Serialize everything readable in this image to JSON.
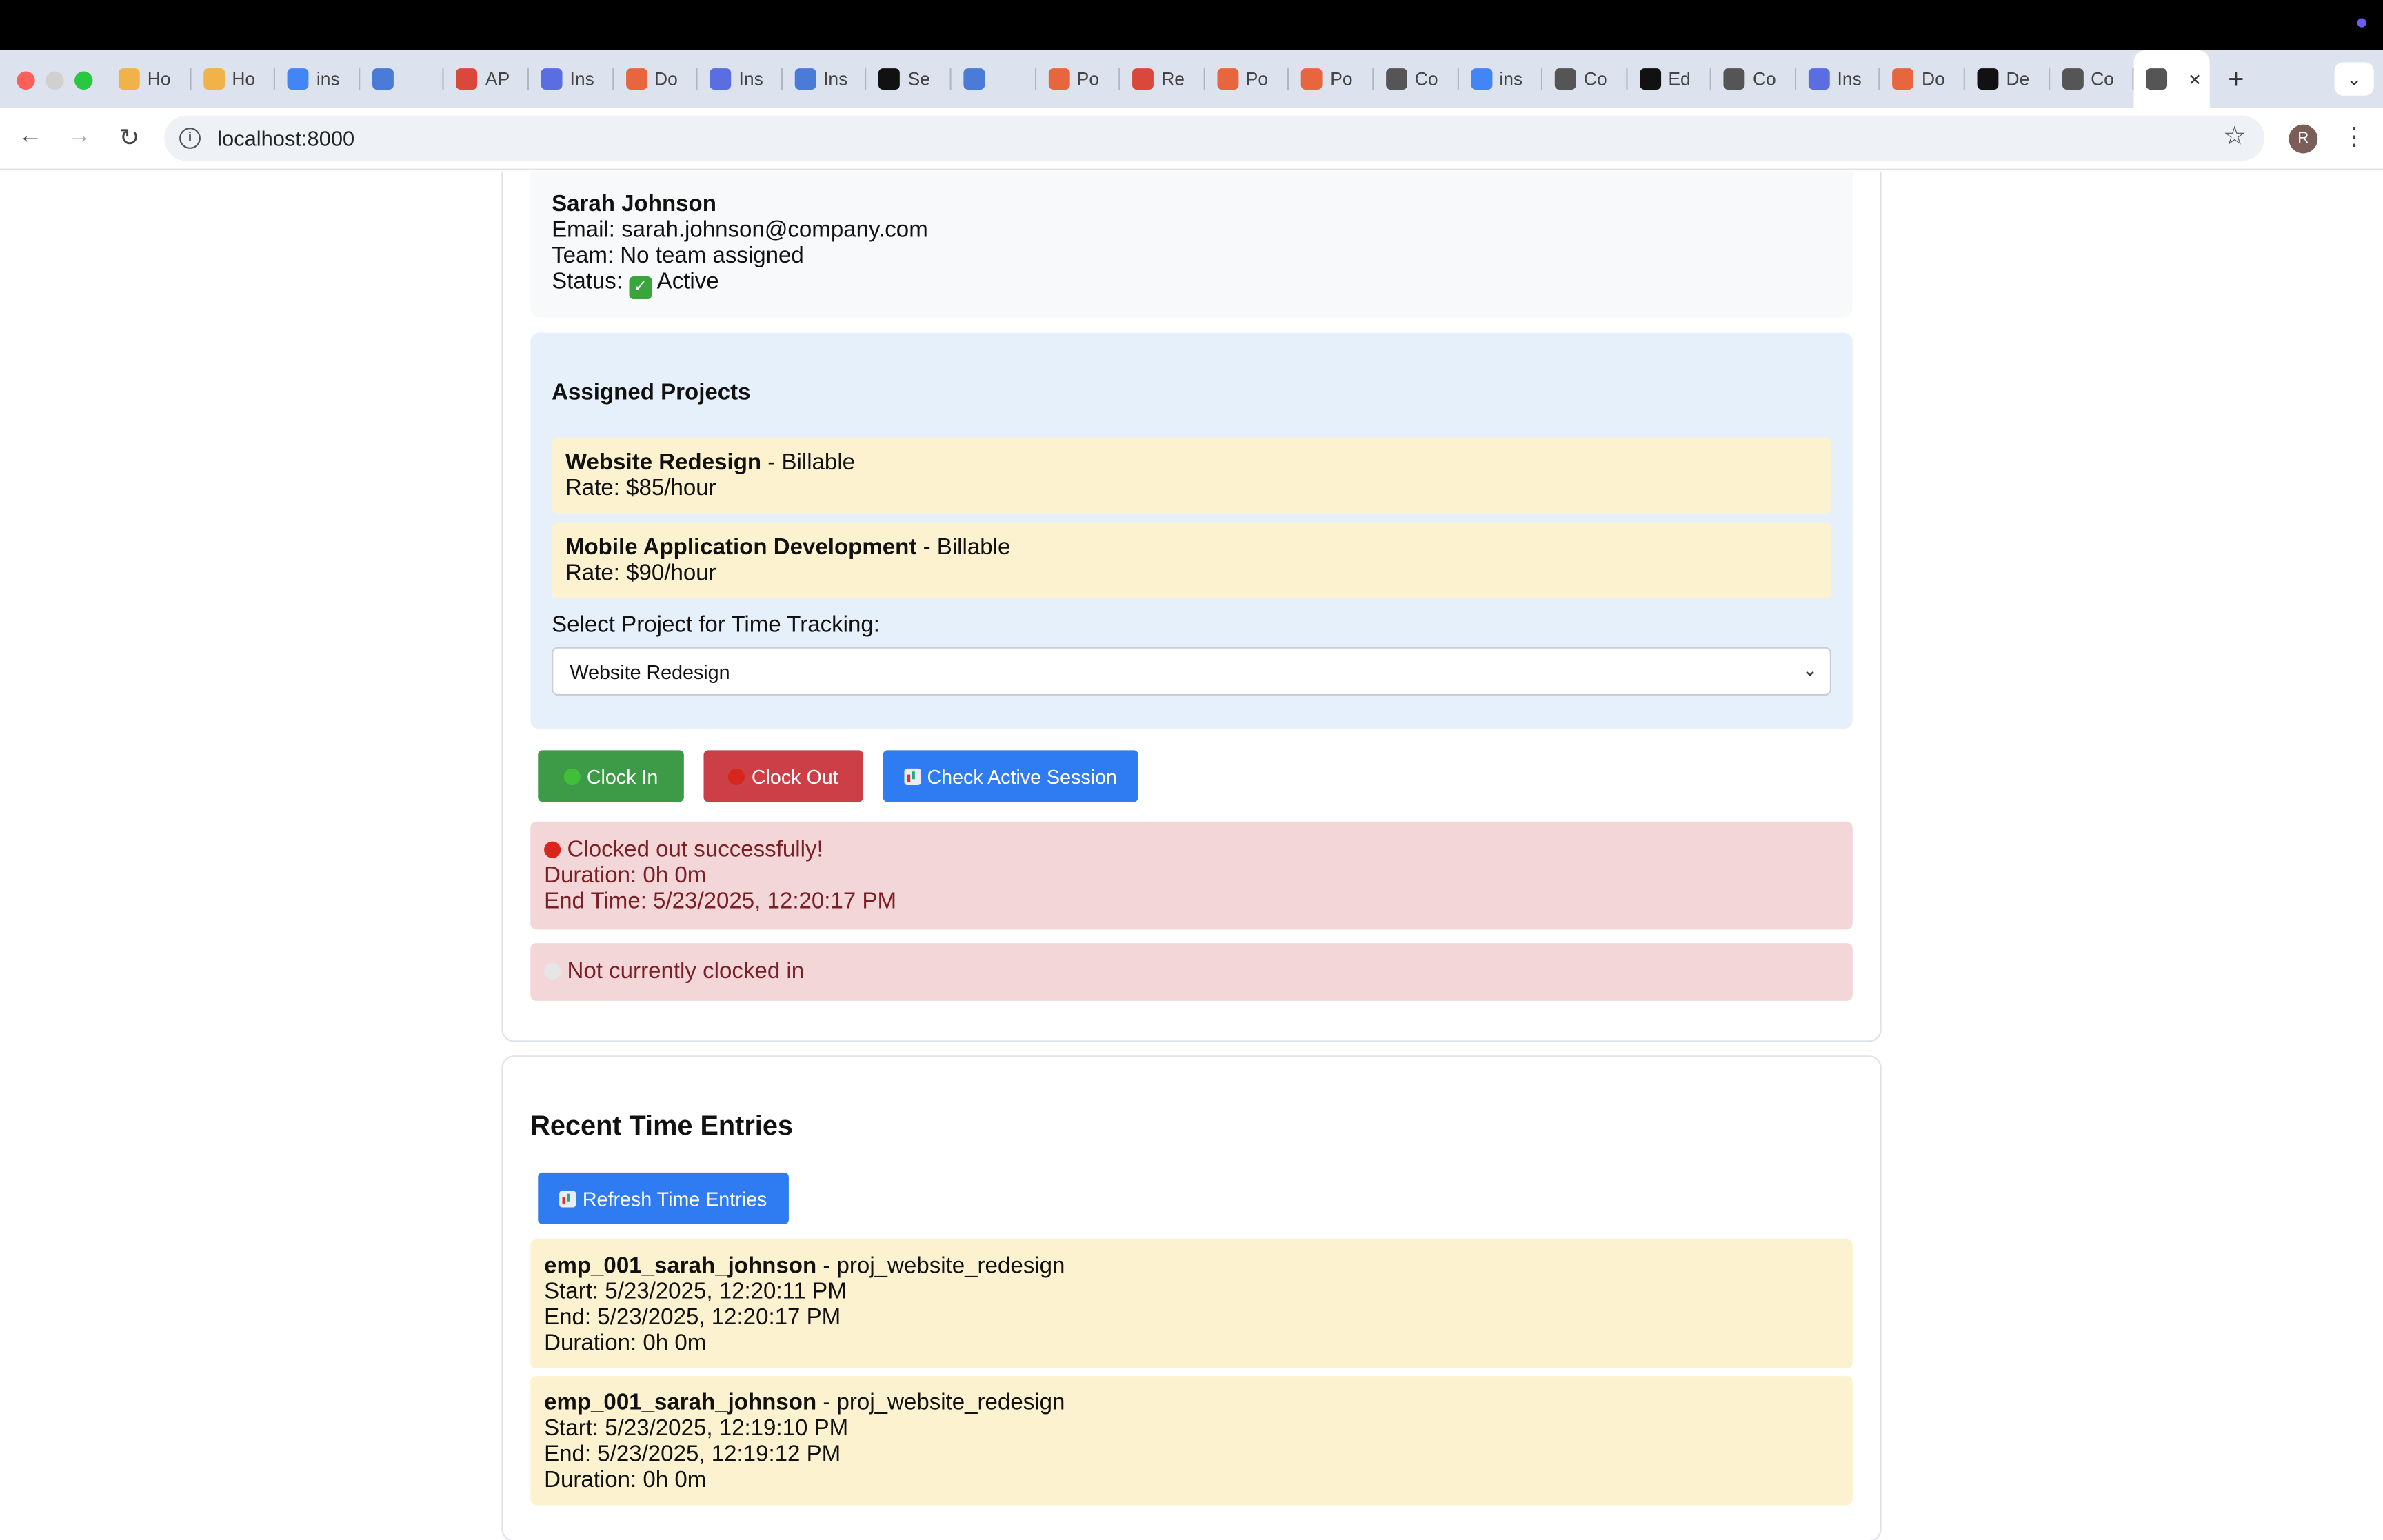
{
  "browser": {
    "tabs": [
      {
        "label": "Ho",
        "icon": "hand-icon",
        "color": "#f2b24a"
      },
      {
        "label": "Ho",
        "icon": "hand-icon",
        "color": "#f2b24a"
      },
      {
        "label": "ins",
        "icon": "google-icon",
        "color": "#4285f4"
      },
      {
        "label": "",
        "icon": "calendar-icon",
        "color": "#4a7bd6"
      },
      {
        "label": "AP",
        "icon": "gmail-icon",
        "color": "#d9483b"
      },
      {
        "label": "Ins",
        "icon": "waveform-icon",
        "color": "#5b6ee1"
      },
      {
        "label": "Do",
        "icon": "orange-circle-icon",
        "color": "#e8663d"
      },
      {
        "label": "Ins",
        "icon": "waveform-icon",
        "color": "#5b6ee1"
      },
      {
        "label": "Ins",
        "icon": "docs-icon",
        "color": "#4a7bd6"
      },
      {
        "label": "Se",
        "icon": "openai-icon",
        "color": "#111111"
      },
      {
        "label": "",
        "icon": "calendar-icon",
        "color": "#4a7bd6"
      },
      {
        "label": "Po",
        "icon": "clock-icon",
        "color": "#e8663d"
      },
      {
        "label": "Re",
        "icon": "gmail-icon",
        "color": "#d9483b"
      },
      {
        "label": "Po",
        "icon": "clock-icon",
        "color": "#e8663d"
      },
      {
        "label": "Po",
        "icon": "clock-icon",
        "color": "#e8663d"
      },
      {
        "label": "Co",
        "icon": "globe-icon",
        "color": "#555555"
      },
      {
        "label": "ins",
        "icon": "google-icon",
        "color": "#4285f4"
      },
      {
        "label": "Co",
        "icon": "globe-icon",
        "color": "#555555"
      },
      {
        "label": "Ed",
        "icon": "github-icon",
        "color": "#111111"
      },
      {
        "label": "Co",
        "icon": "globe-icon",
        "color": "#555555"
      },
      {
        "label": "Ins",
        "icon": "waveform-icon",
        "color": "#5b6ee1"
      },
      {
        "label": "Do",
        "icon": "orange-circle-icon",
        "color": "#e8663d"
      },
      {
        "label": "De",
        "icon": "github-icon",
        "color": "#111111"
      },
      {
        "label": "Co",
        "icon": "globe-icon",
        "color": "#555555"
      }
    ],
    "url": "localhost:8000",
    "avatar_letter": "R"
  },
  "profile": {
    "name": "Sarah Johnson",
    "email": "Email: sarah.johnson@company.com",
    "team": "Team: No team assigned",
    "status_prefix": "Status:",
    "status_value": "Active"
  },
  "projects": {
    "heading": "Assigned Projects",
    "items": [
      {
        "name": "Website Redesign",
        "type": " - Billable",
        "rate": "Rate: $85/hour"
      },
      {
        "name": "Mobile Application Development",
        "type": " - Billable",
        "rate": "Rate: $90/hour"
      }
    ],
    "select_label": "Select Project for Time Tracking:",
    "selected": "Website Redesign"
  },
  "actions": {
    "clock_in": "Clock In",
    "clock_out": "Clock Out",
    "check_session": "Check Active Session"
  },
  "alerts": {
    "clockout_title": "Clocked out successfully!",
    "clockout_duration": "Duration: 0h 0m",
    "clockout_end": "End Time: 5/23/2025, 12:20:17 PM",
    "status_msg": "Not currently clocked in"
  },
  "entries": {
    "heading": "Recent Time Entries",
    "refresh_label": "Refresh Time Entries",
    "items": [
      {
        "employee": "emp_001_sarah_johnson",
        "project": " - proj_website_redesign",
        "start": "Start: 5/23/2025, 12:20:11 PM",
        "end": "End: 5/23/2025, 12:20:17 PM",
        "duration": "Duration: 0h 0m"
      },
      {
        "employee": "emp_001_sarah_johnson",
        "project": " - proj_website_redesign",
        "start": "Start: 5/23/2025, 12:19:10 PM",
        "end": "End: 5/23/2025, 12:19:12 PM",
        "duration": "Duration: 0h 0m"
      }
    ]
  }
}
